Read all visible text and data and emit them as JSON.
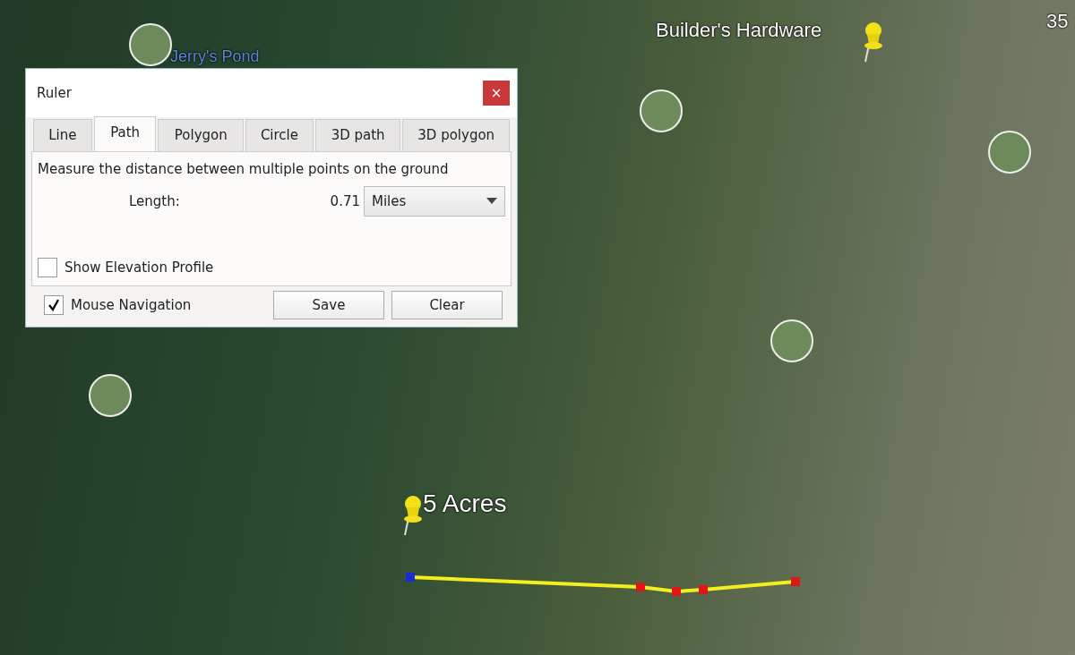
{
  "map": {
    "labels": [
      {
        "text": "Jerry's Pond",
        "kind": "place"
      },
      {
        "text": "Builder's Hardware",
        "kind": "place"
      },
      {
        "text": "35",
        "kind": "road"
      },
      {
        "text": "5 Acres",
        "kind": "placemark"
      }
    ]
  },
  "dialog": {
    "title": "Ruler",
    "close": "×",
    "tabs": [
      {
        "label": "Line",
        "selected": false
      },
      {
        "label": "Path",
        "selected": true
      },
      {
        "label": "Polygon",
        "selected": false
      },
      {
        "label": "Circle",
        "selected": false
      },
      {
        "label": "3D path",
        "selected": false
      },
      {
        "label": "3D polygon",
        "selected": false
      }
    ],
    "description": "Measure the distance between multiple points on the ground",
    "length_label": "Length:",
    "length_value": "0.71",
    "unit": "Miles",
    "elevation_profile": {
      "label": "Show Elevation Profile",
      "checked": false
    },
    "mouse_navigation": {
      "label": "Mouse Navigation",
      "checked": true
    },
    "buttons": [
      "Save",
      "Clear"
    ]
  }
}
